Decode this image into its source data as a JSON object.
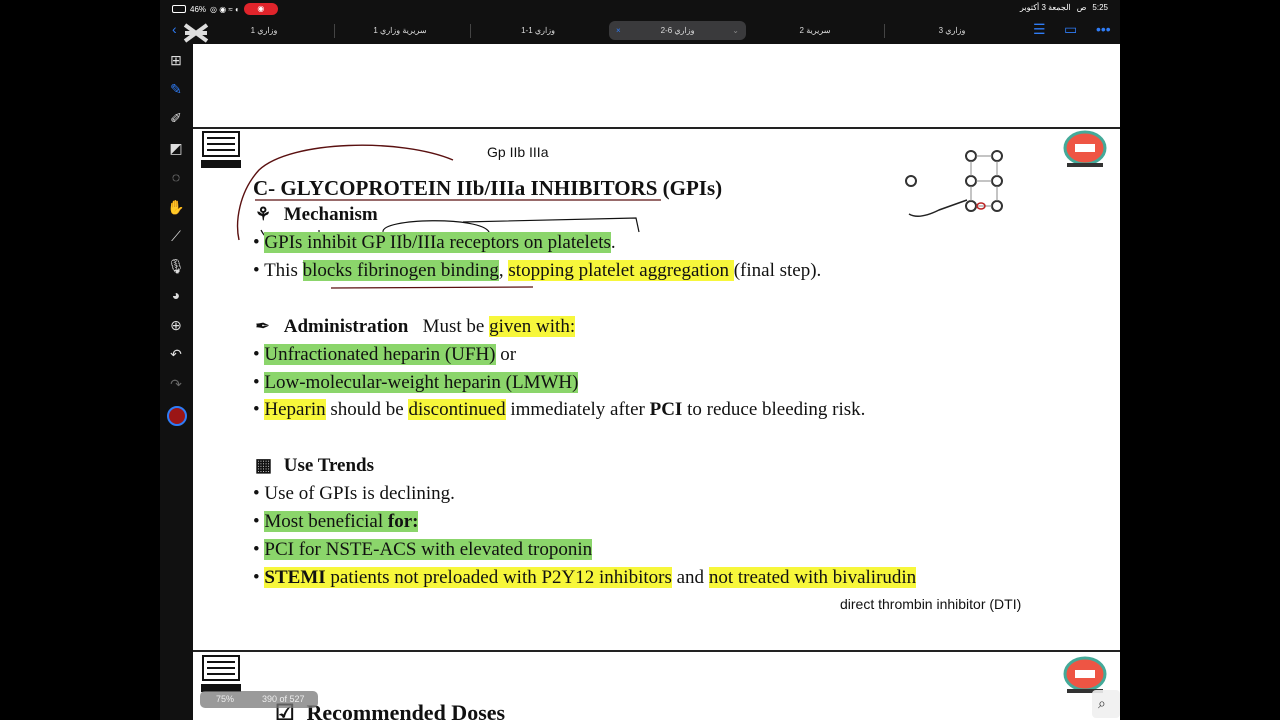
{
  "status": {
    "time": "5:25",
    "date": "الجمعة 3 أكتوبر",
    "period": "ص",
    "battery": "46%"
  },
  "tabs": [
    {
      "label": "وزاري 1",
      "active": false
    },
    {
      "label": "سريرية وزاري 1",
      "active": false
    },
    {
      "label": "وزاري 1-1",
      "active": false
    },
    {
      "label": "وزاري 6-2",
      "active": true
    },
    {
      "label": "سريرية 2",
      "active": false
    },
    {
      "label": "وزاري 3",
      "active": false
    }
  ],
  "annotations": {
    "top": "Gp IIb IIIa",
    "bottom": "direct thrombin inhibitor (DTI)"
  },
  "slide": {
    "title": "C-  GLYCOPROTEIN IIb/IIIa INHIBITORS (GPIs)",
    "mechanism": {
      "heading": "Mechanism",
      "b1": {
        "p1": "GPIs",
        "p2": " inhibit ",
        "p3": "GP IIb/IIIa",
        "p4": " receptors on platelets",
        "p5": "."
      },
      "b2": {
        "p1": "This ",
        "p2": "blocks fibrinogen binding",
        "p3": ", ",
        "p4": "stopping platelet aggregation ",
        "p5": "(final step)."
      }
    },
    "administration": {
      "heading": "Administration",
      "must": "Must be ",
      "given": "given with:",
      "b1": {
        "p1": "Unfractionated heparin (UFH)",
        "p2": " or"
      },
      "b2": "Low-molecular-weight heparin (LMWH)",
      "b3": {
        "p1": "Heparin",
        "p2": " should be ",
        "p3": "discontinued",
        "p4": " immediately after ",
        "p5": "PCI",
        "p6": " to reduce bleeding risk."
      }
    },
    "trends": {
      "heading": "Use Trends",
      "b1": "Use of GPIs is declining.",
      "b2": {
        "p1": "Most beneficial ",
        "p2": "for:"
      },
      "b3": "PCI for NSTE-ACS with elevated troponin",
      "b4": {
        "p1": "STEMI",
        "p2": " patients ",
        "p3": "not preloaded with P2Y12 ",
        "p4": "inhibitors",
        "p5": " and ",
        "p6": "not treated with bivalirudin"
      }
    },
    "next_heading": "Recommended Doses"
  },
  "footer": {
    "zoom": "75%",
    "pages": "390 of 527"
  },
  "colors": {
    "highlight_green": "#8bd56b",
    "highlight_yellow": "#f7f73b",
    "accent": "#2f7cf6"
  }
}
